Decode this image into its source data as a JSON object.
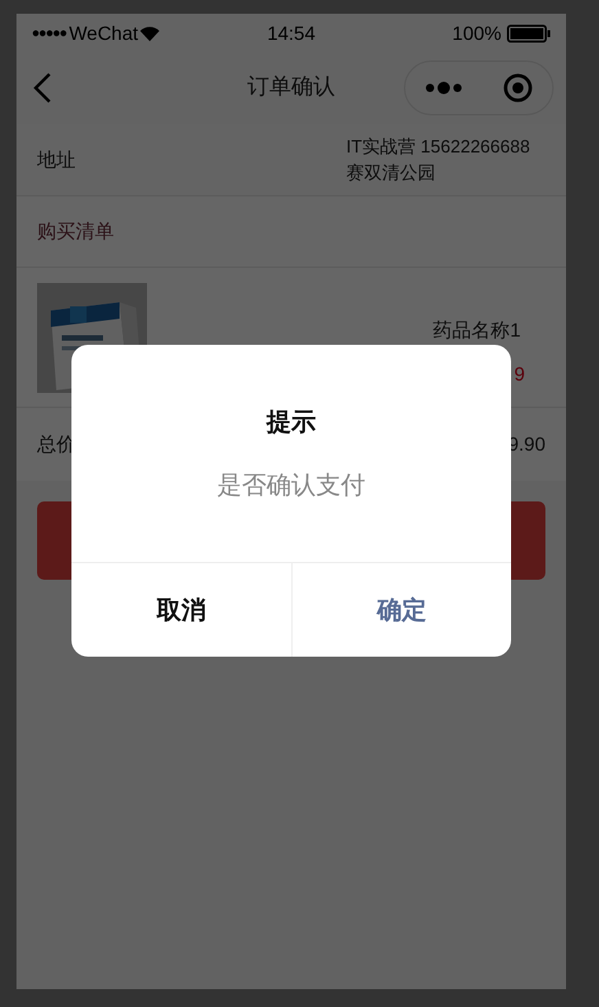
{
  "status_bar": {
    "signal": "●●●●●",
    "carrier": "WeChat",
    "time": "14:54",
    "battery": "100%"
  },
  "nav_bar": {
    "title": "订单确认"
  },
  "address": {
    "label": "地址",
    "line_1": "IT实战营 15622266688",
    "line_2": "赛双清公园"
  },
  "list_header": {
    "label": "购买清单"
  },
  "product": {
    "name": "药品名称1",
    "price": "9"
  },
  "total": {
    "label": "总价",
    "value": "9.90"
  },
  "dialog": {
    "title": "提示",
    "message": "是否确认支付",
    "buttons": [
      {
        "label": "取消",
        "kind": "cancel"
      },
      {
        "label": "确定",
        "kind": "confirm"
      }
    ]
  }
}
